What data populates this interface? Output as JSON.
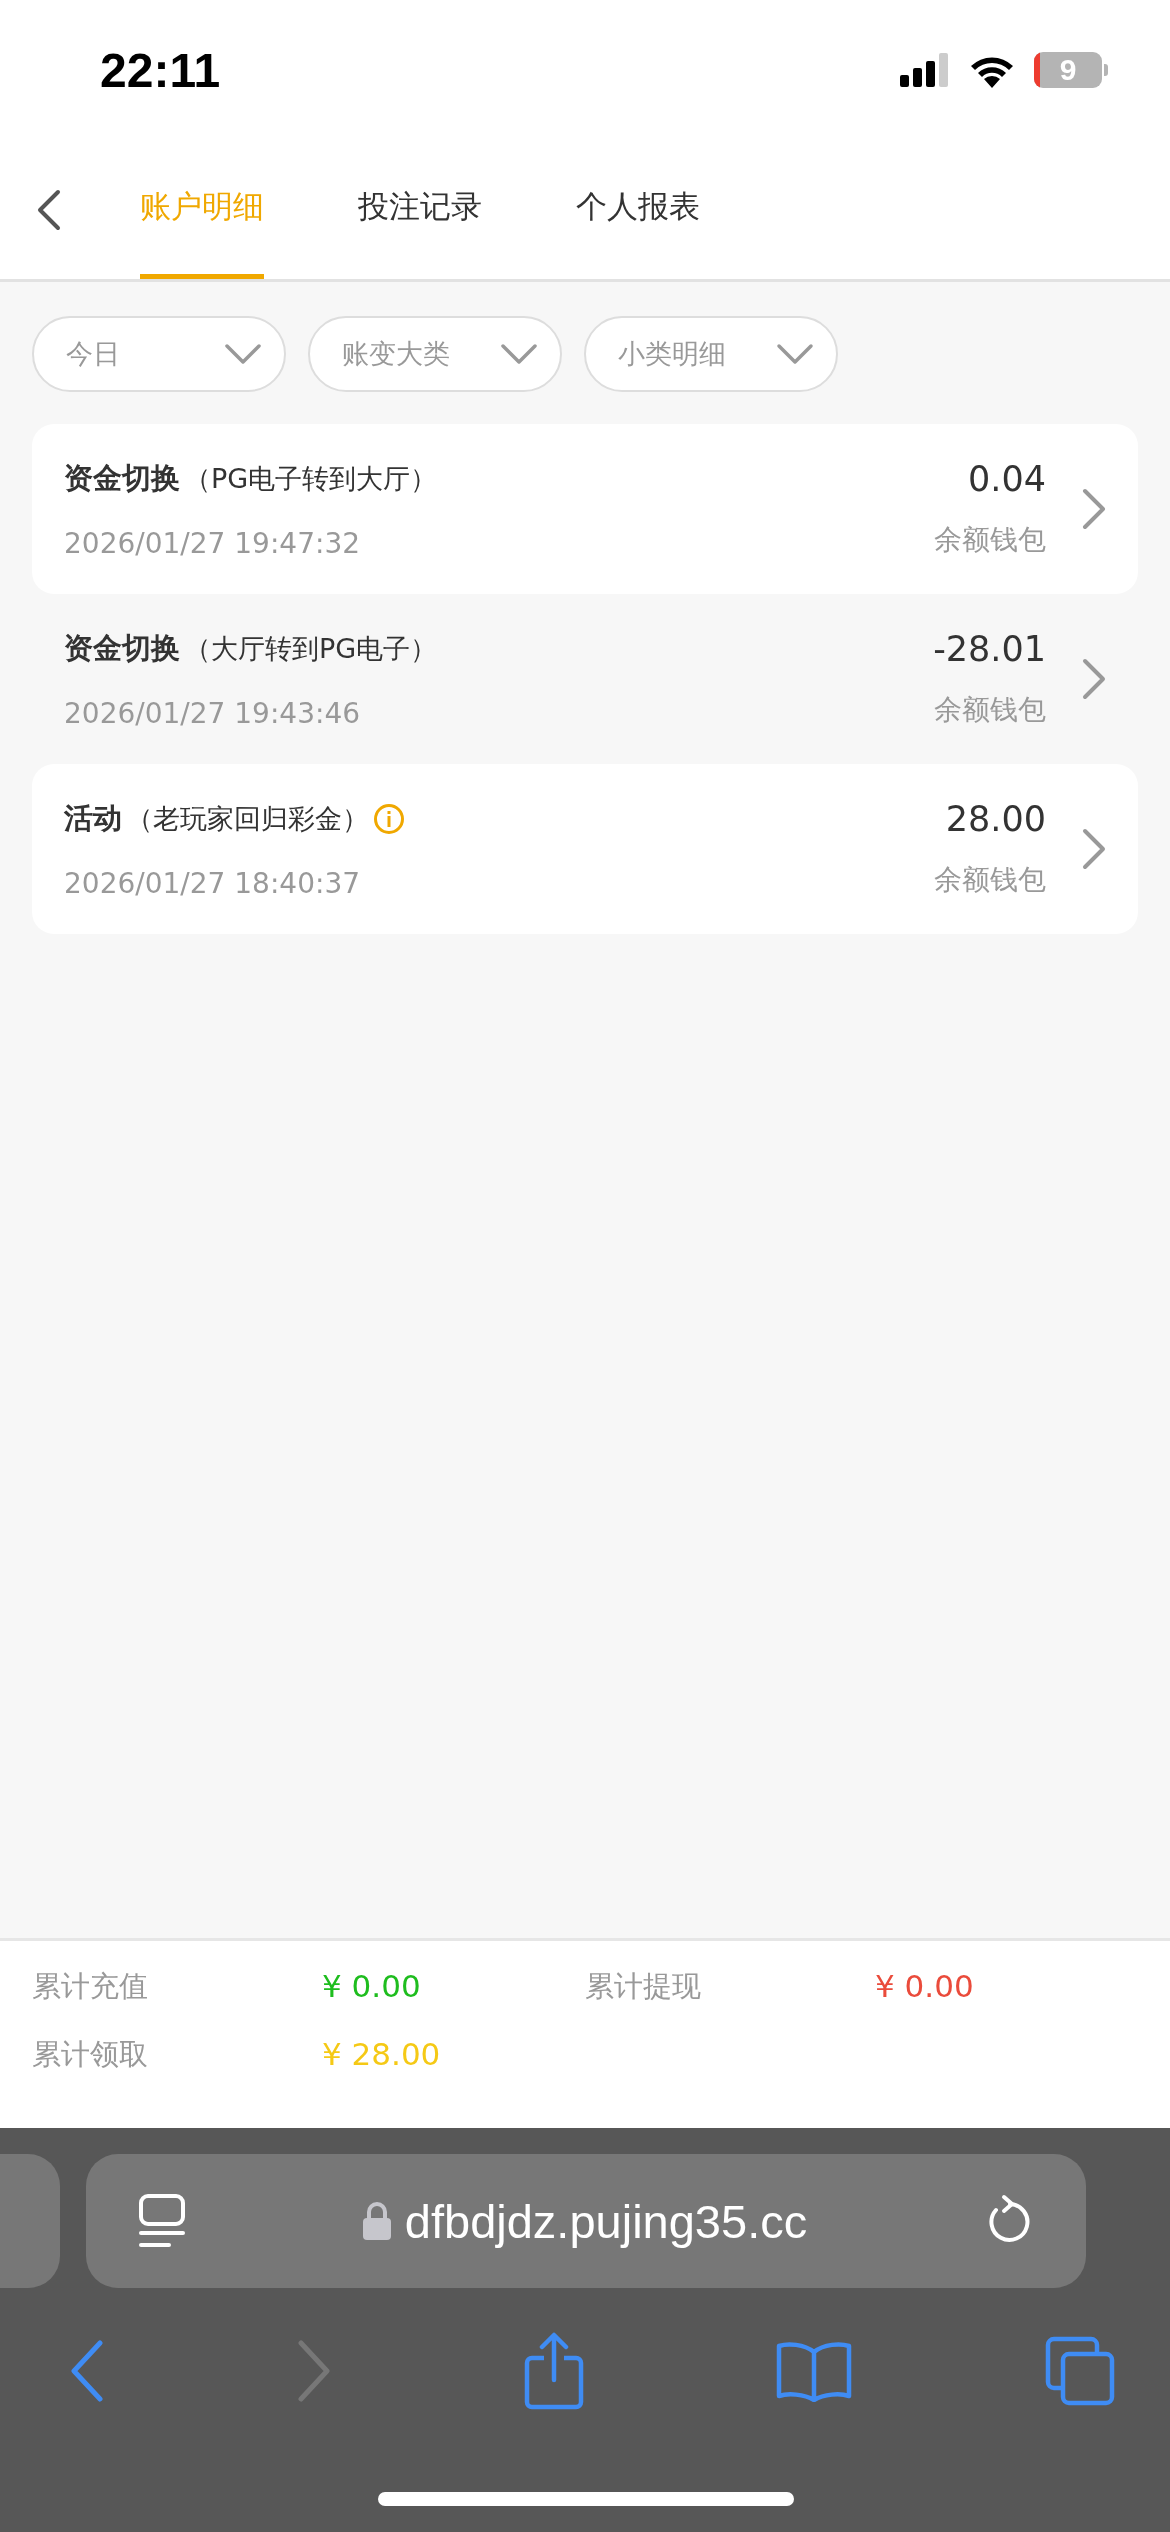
{
  "status_bar": {
    "time": "22:11",
    "battery": "9"
  },
  "tabs": [
    {
      "label": "账户明细",
      "selected": true
    },
    {
      "label": "投注记录",
      "selected": false
    },
    {
      "label": "个人报表",
      "selected": false
    }
  ],
  "filters": [
    {
      "label": "今日"
    },
    {
      "label": "账变大类"
    },
    {
      "label": "小类明细"
    }
  ],
  "records": [
    {
      "title": "资金切换",
      "detail": "（PG电子转到大厅）",
      "info": false,
      "time": "2026/01/27 19:47:32",
      "amount": "0.04",
      "wallet": "余额钱包"
    },
    {
      "title": "资金切换",
      "detail": "（大厅转到PG电子）",
      "info": false,
      "time": "2026/01/27 19:43:46",
      "amount": "-28.01",
      "wallet": "余额钱包"
    },
    {
      "title": "活动",
      "detail": "（老玩家回归彩金）",
      "info": true,
      "time": "2026/01/27 18:40:37",
      "amount": "28.00",
      "wallet": "余额钱包"
    }
  ],
  "summary": [
    {
      "label": "累计充值",
      "value": "¥ 0.00",
      "color": "#1ebd1e"
    },
    {
      "label": "累计提现",
      "value": "¥ 0.00",
      "color": "#ea4b3b"
    },
    {
      "label": "累计领取",
      "value": "¥ 28.00",
      "color": "#f5c915"
    }
  ],
  "browser": {
    "url": "dfbdjdz.pujing35.cc"
  }
}
